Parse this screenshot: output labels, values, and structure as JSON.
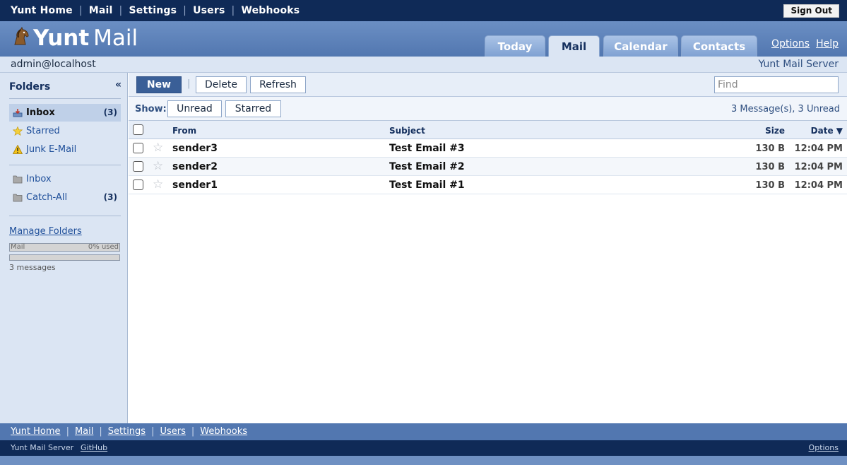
{
  "topnav": {
    "items": [
      "Yunt Home",
      "Mail",
      "Settings",
      "Users",
      "Webhooks"
    ],
    "sign_out": "Sign Out"
  },
  "banner": {
    "logo_brand": "Yunt",
    "logo_product": "Mail",
    "tabs": [
      "Today",
      "Mail",
      "Calendar",
      "Contacts"
    ],
    "active_tab": "Mail",
    "options_link": "Options",
    "help_link": "Help"
  },
  "account": {
    "user": "admin@localhost",
    "server": "Yunt Mail Server"
  },
  "sidebar": {
    "title": "Folders",
    "collapse": "«",
    "system_folders": [
      {
        "label": "Inbox",
        "count": "(3)",
        "icon": "inbox-icon",
        "selected": true
      },
      {
        "label": "Starred",
        "count": "",
        "icon": "star-icon"
      },
      {
        "label": "Junk E-Mail",
        "count": "",
        "icon": "warning-icon"
      }
    ],
    "user_folders": [
      {
        "label": "Inbox",
        "count": "",
        "icon": "folder-icon"
      },
      {
        "label": "Catch-All",
        "count": "(3)",
        "icon": "folder-icon"
      }
    ],
    "manage_folders": "Manage Folders",
    "quota_label": "Mail",
    "quota_used": "0% used",
    "quota_fraction": 0,
    "messages": "3 messages"
  },
  "toolbar": {
    "new": "New",
    "delete": "Delete",
    "refresh": "Refresh",
    "find_placeholder": "Find"
  },
  "filter": {
    "label": "Show:",
    "unread": "Unread",
    "starred": "Starred",
    "summary": "3 Message(s), 3 Unread"
  },
  "table": {
    "columns": {
      "from": "From",
      "subject": "Subject",
      "size": "Size",
      "date": "Date ▼"
    },
    "rows": [
      {
        "from": "sender3",
        "subject": "Test Email #3",
        "size": "130 B",
        "date": "12:04 PM"
      },
      {
        "from": "sender2",
        "subject": "Test Email #2",
        "size": "130 B",
        "date": "12:04 PM"
      },
      {
        "from": "sender1",
        "subject": "Test Email #1",
        "size": "130 B",
        "date": "12:04 PM"
      }
    ]
  },
  "footer": {
    "links": [
      "Yunt Home",
      "Mail",
      "Settings",
      "Users",
      "Webhooks"
    ],
    "server": "Yunt Mail Server",
    "github": "GitHub",
    "options": "Options"
  },
  "colors": {
    "navy": "#0f2a57",
    "banner_blue": "#5277b0",
    "panel": "#dbe5f3",
    "primary_button": "#3a5f97"
  }
}
